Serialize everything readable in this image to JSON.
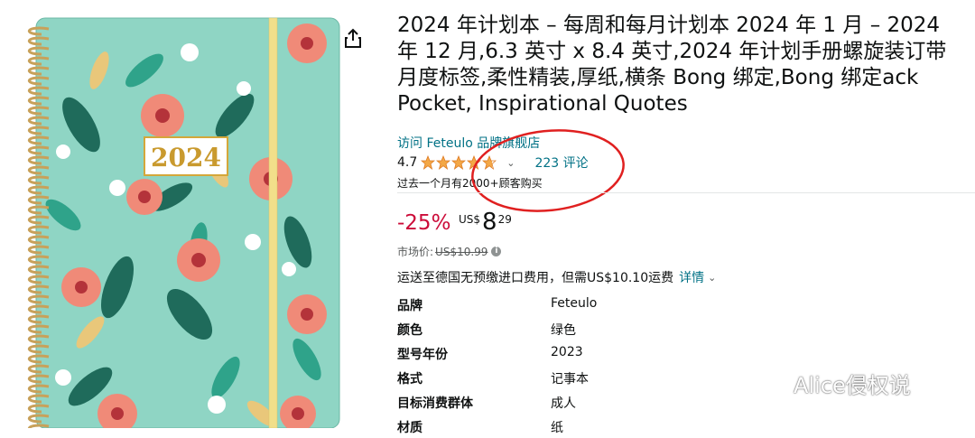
{
  "product": {
    "image_alt": "2024 notebook with floral cover",
    "cover_year": "2024",
    "title": "2024 年计划本 – 每周和每月计划本 2024 年 1 月 – 2024 年 12 月,6.3 英寸 x 8.4 英寸,2024 年计划手册螺旋装订带月度标签,柔性精装,厚纸,横条 Bong 绑定,Bong 绑定ack Pocket, Inspirational Quotes",
    "store_link": "访问 Feteulo 品牌旗舰店",
    "rating_value": "4.7",
    "rating_fraction": 0.94,
    "reviews": "223 评论",
    "bought": "过去一个月有2000+顾客购买"
  },
  "pricing": {
    "discount": "-25%",
    "currency": "US$",
    "whole": "8",
    "fraction": "29",
    "list_label": "市场价:",
    "list_price": "US$10.99",
    "shipping": "运送至德国无预缴进口费用，但需US$10.10运费",
    "details": "详情"
  },
  "specs": [
    {
      "key": "品牌",
      "value": "Feteulo"
    },
    {
      "key": "颜色",
      "value": "绿色"
    },
    {
      "key": "型号年份",
      "value": "2023"
    },
    {
      "key": "格式",
      "value": "记事本"
    },
    {
      "key": "目标消费群体",
      "value": "成人"
    },
    {
      "key": "材质",
      "value": "纸"
    }
  ],
  "watermark": "Alice侵权说",
  "colors": {
    "cover": "#8fd5c4",
    "link": "#007185",
    "discount": "#cc0c39",
    "star": "#f3a847",
    "annotation": "#e02020"
  }
}
